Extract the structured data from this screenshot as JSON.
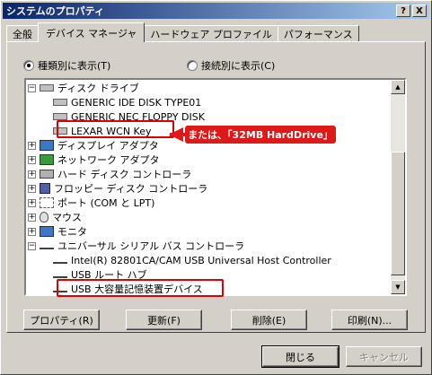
{
  "window": {
    "title": "システムのプロパティ",
    "help_btn": "?",
    "close_btn": "X"
  },
  "tabs": [
    {
      "label": "全般"
    },
    {
      "label": "デバイス マネージャ"
    },
    {
      "label": "ハードウェア プロファイル"
    },
    {
      "label": "パフォーマンス"
    }
  ],
  "view": {
    "by_type": "種類別に表示(T)",
    "by_connection": "接続別に表示(C)"
  },
  "tree": [
    {
      "label": "ディスク ドライブ",
      "expander": "−",
      "icon": "disk-icon",
      "level": 0
    },
    {
      "label": "GENERIC IDE  DISK TYPE01",
      "icon": "disk-icon",
      "level": 1
    },
    {
      "label": "GENERIC NEC  FLOPPY DISK",
      "icon": "disk-icon",
      "level": 1
    },
    {
      "label": "LEXAR WCN Key",
      "icon": "disk-icon",
      "level": 1
    },
    {
      "label": "ディスプレイ アダプタ",
      "expander": "+",
      "icon": "monitor-icon",
      "level": 0
    },
    {
      "label": "ネットワーク アダプタ",
      "expander": "+",
      "icon": "network-icon",
      "level": 0
    },
    {
      "label": "ハード ディスク コントローラ",
      "expander": "+",
      "icon": "controller-icon",
      "level": 0
    },
    {
      "label": "フロッピー ディスク コントローラ",
      "expander": "+",
      "icon": "floppy-icon",
      "level": 0
    },
    {
      "label": "ポート (COM と LPT)",
      "expander": "+",
      "icon": "port-icon",
      "level": 0
    },
    {
      "label": "マウス",
      "expander": "+",
      "icon": "mouse-icon",
      "level": 0
    },
    {
      "label": "モニタ",
      "expander": "+",
      "icon": "monitor-icon",
      "level": 0
    },
    {
      "label": "ユニバーサル シリアル バス コントローラ",
      "expander": "−",
      "icon": "usb-icon",
      "level": 0
    },
    {
      "label": "Intel(R) 82801CA/CAM USB Universal Host Controller",
      "icon": "usb-icon",
      "level": 1
    },
    {
      "label": "USB ルート ハブ",
      "icon": "usb-icon",
      "level": 1
    },
    {
      "label": "USB 大容量記憶装置デバイス",
      "icon": "usb-icon",
      "level": 1
    }
  ],
  "annotation": {
    "callout": "または、「32MB HardDrive」"
  },
  "buttons": {
    "properties": "プロパティ(R)",
    "refresh": "更新(F)",
    "remove": "削除(E)",
    "print": "印刷(N)...",
    "close": "閉じる",
    "cancel": "キャンセル"
  },
  "colors": {
    "titlebar_start": "#0a246a",
    "titlebar_end": "#a6caf0",
    "annotation_red": "#e01818",
    "face": "#d4d0c8"
  }
}
